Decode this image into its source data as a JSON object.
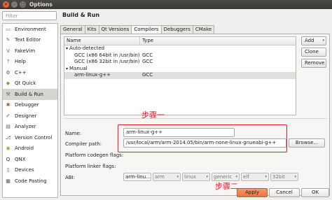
{
  "window": {
    "title": "Options",
    "close_glyph": "✕",
    "min_glyph": "–",
    "max_glyph": "□"
  },
  "filter": {
    "placeholder": "Filter"
  },
  "categories": [
    {
      "label": "Environment",
      "icon": "monitor-icon",
      "glyph": "▭",
      "color": "#4a6fa8"
    },
    {
      "label": "Text Editor",
      "icon": "text-editor-icon",
      "glyph": "✎",
      "color": "#666"
    },
    {
      "label": "FakeVim",
      "icon": "fakevim-icon",
      "glyph": "V",
      "color": "#3d8a3d"
    },
    {
      "label": "Help",
      "icon": "help-icon",
      "glyph": "?",
      "color": "#3a6fb5"
    },
    {
      "label": "C++",
      "icon": "cpp-icon",
      "glyph": "⚙",
      "color": "#555"
    },
    {
      "label": "Qt Quick",
      "icon": "qt-quick-icon",
      "glyph": "◆",
      "color": "#6aaa3a"
    },
    {
      "label": "Build & Run",
      "icon": "build-run-icon",
      "glyph": "⚒",
      "color": "#666"
    },
    {
      "label": "Debugger",
      "icon": "debugger-icon",
      "glyph": "✱",
      "color": "#a3542a"
    },
    {
      "label": "Designer",
      "icon": "designer-icon",
      "glyph": "✐",
      "color": "#6a5aa8"
    },
    {
      "label": "Analyzer",
      "icon": "analyzer-icon",
      "glyph": "▤",
      "color": "#555"
    },
    {
      "label": "Version Control",
      "icon": "version-control-icon",
      "glyph": "⎇",
      "color": "#555"
    },
    {
      "label": "Android",
      "icon": "android-icon",
      "glyph": "◉",
      "color": "#7cb342"
    },
    {
      "label": "QNX",
      "icon": "qnx-icon",
      "glyph": "Q",
      "color": "#333"
    },
    {
      "label": "Devices",
      "icon": "devices-icon",
      "glyph": "▯",
      "color": "#555"
    },
    {
      "label": "Code Pasting",
      "icon": "code-pasting-icon",
      "glyph": "▦",
      "color": "#555"
    }
  ],
  "page_title": "Build & Run",
  "tabs": [
    "General",
    "Kits",
    "Qt Versions",
    "Compilers",
    "Debuggers",
    "CMake"
  ],
  "active_tab": "Compilers",
  "tree": {
    "columns": [
      "Name",
      "Type"
    ],
    "rows": [
      {
        "name": "Auto-detected",
        "type": "",
        "indent": 0,
        "arrow": "▾"
      },
      {
        "name": "GCC (x86 64bit in /usr/bin)",
        "type": "GCC",
        "indent": 2,
        "arrow": ""
      },
      {
        "name": "GCC (x86 32bit in /usr/bin)",
        "type": "GCC",
        "indent": 2,
        "arrow": ""
      },
      {
        "name": "Manual",
        "type": "",
        "indent": 0,
        "arrow": "▾"
      },
      {
        "name": "arm-linux-g++",
        "type": "GCC",
        "indent": 2,
        "arrow": "",
        "selected": true
      }
    ]
  },
  "side_buttons": {
    "add": "Add",
    "add_arrow": "▾",
    "clone": "Clone",
    "remove": "Remove"
  },
  "form": {
    "name_label": "Name:",
    "name_value": "arm-linux-g++",
    "compiler_path_label": "Compiler path:",
    "compiler_path_value": "/usr/local/arm/arm-2014.05/bin/arm-none-linux-gnueabi-g++",
    "browse_label": "Browse...",
    "codegen_label": "Platform codegen flags:",
    "linker_label": "Platform linker flags:",
    "abi_label": "ABI:",
    "abi_values": [
      "arm-linu...",
      "arm",
      "linux",
      "generic",
      "elf",
      "32bit"
    ]
  },
  "annotations": {
    "step1": "步骤一",
    "step2": "步骤二"
  },
  "footer": {
    "apply": "Apply",
    "cancel": "Cancel",
    "ok": "OK"
  },
  "colors": {
    "annotation": "#e0202a",
    "apply_button": "#e8733f",
    "selection": "#d6d4d0"
  }
}
